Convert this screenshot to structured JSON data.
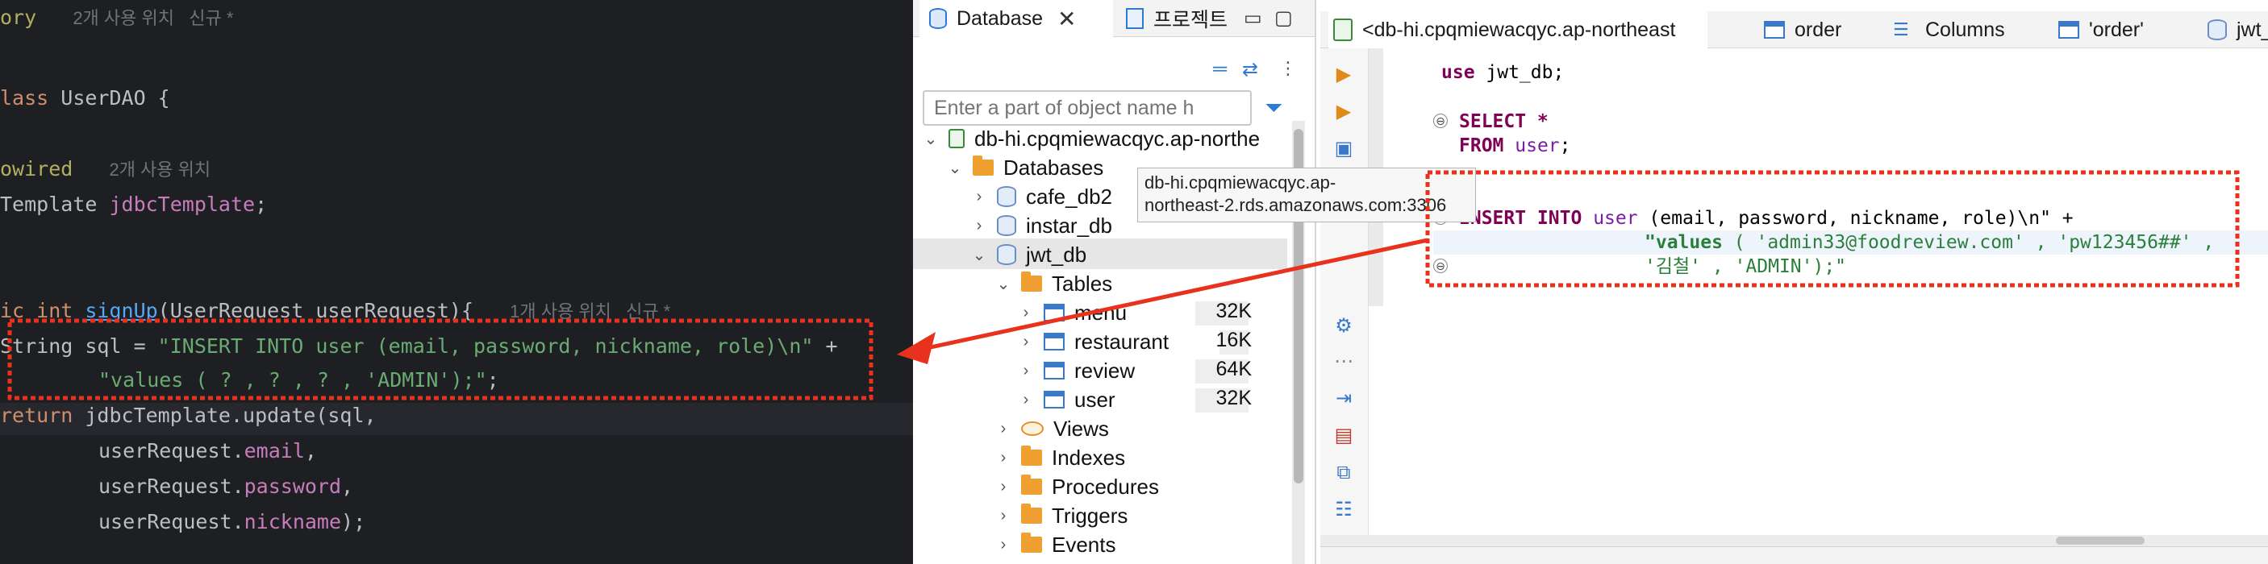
{
  "ide": {
    "lines": [
      {
        "text": "ory",
        "hint": "2개 사용 위치   신규 *"
      },
      {
        "kw": "lass",
        "text": " UserDAO {"
      },
      {
        "ann": "owired",
        "hint": "2개 사용 위치"
      },
      {
        "text": "Template ",
        "fld": "jdbcTemplate",
        "tail": ";"
      },
      {
        "kw": "ic int ",
        "fn": "signUp",
        "text": "(UserRequest userRequest){",
        "hint": "1개 사용 위치   신규 *"
      },
      {
        "text": "String sql = ",
        "str": "\"INSERT INTO user (email, password, nickname, role)\\n\"",
        "tail": " +"
      },
      {
        "str": "\"values ( ? , ? , ? , 'ADMIN');\"",
        "tail": ";"
      },
      {
        "kw": "return ",
        "text": "jdbcTemplate.update(sql,"
      },
      {
        "text": "userRequest.",
        "fld": "email",
        "tail": ","
      },
      {
        "text": "userRequest.",
        "fld": "password",
        "tail": ","
      },
      {
        "text": "userRequest.",
        "fld": "nickname",
        "tail": ");"
      }
    ]
  },
  "navigator": {
    "tabs": {
      "database": "Database",
      "project": "프로젝트"
    },
    "search_placeholder": "Enter a part of object name h",
    "tree": {
      "connection": "db-hi.cpqmiewacqyc.ap-northe",
      "databases": "Databases",
      "db1": "cafe_db2",
      "db2": "instar_db",
      "db3": "jwt_db",
      "tables": "Tables",
      "t1": {
        "name": "menu",
        "size": "32K"
      },
      "t2": {
        "name": "restaurant",
        "size": "16K"
      },
      "t3": {
        "name": "review",
        "size": "64K"
      },
      "t4": {
        "name": "user",
        "size": "32K"
      },
      "views": "Views",
      "indexes": "Indexes",
      "procedures": "Procedures",
      "triggers": "Triggers",
      "events": "Events"
    }
  },
  "tooltip": {
    "line1": "db-hi.cpqmiewacqyc.ap-",
    "line2": "northeast-2.rds.amazonaws.com:3306"
  },
  "editor": {
    "tabs": {
      "connection": "<db-hi.cpqmiewacqyc.ap-northeast",
      "order": "order",
      "columns": "Columns",
      "order_q": "'order'",
      "jwt": "jwt_"
    },
    "sql": {
      "use_kw": "use",
      "use_rest": " jwt_db;",
      "select": "SELECT *",
      "from_kw": "FROM",
      "from_id": "user",
      "insert_kw1": "INSERT INTO",
      "insert_id": "user",
      "insert_rest": " (email, password, nickname, role)\\n\" +",
      "values_str": "\"values",
      "values_rest": " ( 'admin33@foodreview.com' , 'pw123456##' ,",
      "last_str": "'김철' , 'ADMIN');\""
    }
  },
  "colors": {
    "annotation_red": "#e8321e",
    "ide_bg": "#1e1f22"
  }
}
